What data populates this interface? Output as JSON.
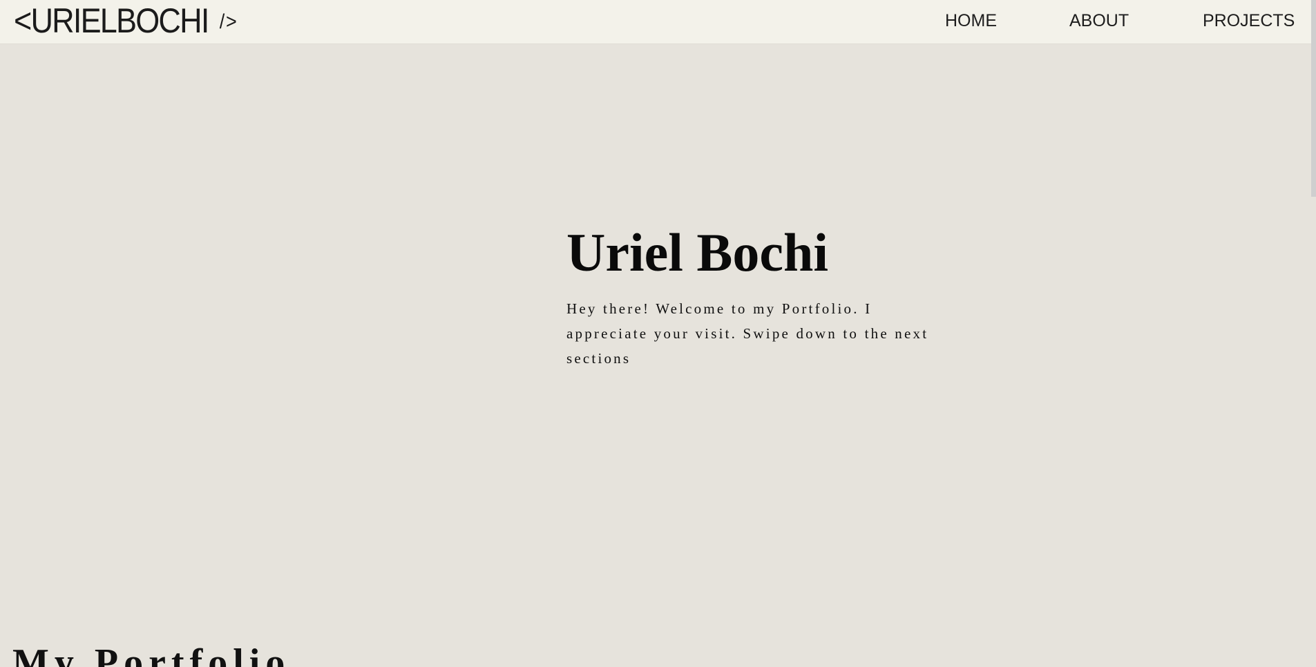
{
  "navbar": {
    "logo_text": "<URIELBOCHI",
    "logo_suffix": "/>",
    "links": [
      {
        "label": "HOME"
      },
      {
        "label": "ABOUT"
      },
      {
        "label": "PROJECTS"
      }
    ]
  },
  "hero": {
    "title": "Uriel Bochi",
    "text": "Hey there! Welcome to my Portfolio. I appreciate your visit. Swipe down to the next sections"
  },
  "portfolio": {
    "title": "My Portfolio"
  },
  "colors": {
    "background": "#e6e3dc",
    "navbar": "#f3f2ea",
    "text": "#161616"
  }
}
